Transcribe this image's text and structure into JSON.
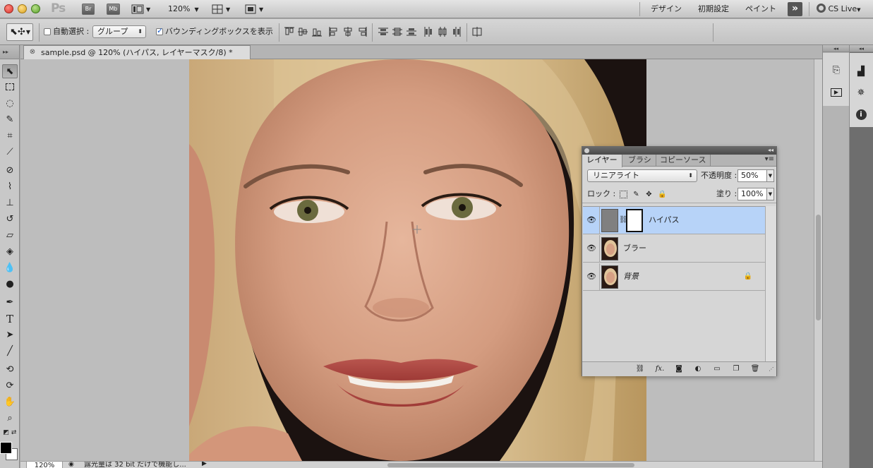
{
  "app": {
    "logo": "Ps",
    "btn_br": "Br",
    "btn_mb": "Mb",
    "zoom_menu": "120%",
    "workspaces": [
      "デザイン",
      "初期設定",
      "ペイント"
    ],
    "cs_live": "CS Live"
  },
  "options": {
    "auto_select_label": "自動選択 :",
    "auto_select_value": "グループ",
    "bounding_box_label": "バウンディングボックスを表示"
  },
  "document": {
    "tab_title": "sample.psd @ 120% (ハイパス, レイヤーマスク/8) *"
  },
  "status": {
    "zoom": "120%",
    "message": "露光量は 32 bit だけで機能し..."
  },
  "layers_panel": {
    "tabs": [
      "レイヤー",
      "ブラシ",
      "コピーソース"
    ],
    "blend_mode": "リニアライト",
    "opacity_label": "不透明度 :",
    "opacity_value": "50%",
    "lock_label": "ロック :",
    "fill_label": "塗り :",
    "fill_value": "100%",
    "layers": [
      {
        "name": "ハイパス",
        "selected": true
      },
      {
        "name": "ブラー",
        "selected": false
      },
      {
        "name": "背景",
        "selected": false
      }
    ]
  },
  "colors": {
    "selection": "#b7d3f8",
    "foreground": "#000000",
    "background": "#ffffff"
  }
}
